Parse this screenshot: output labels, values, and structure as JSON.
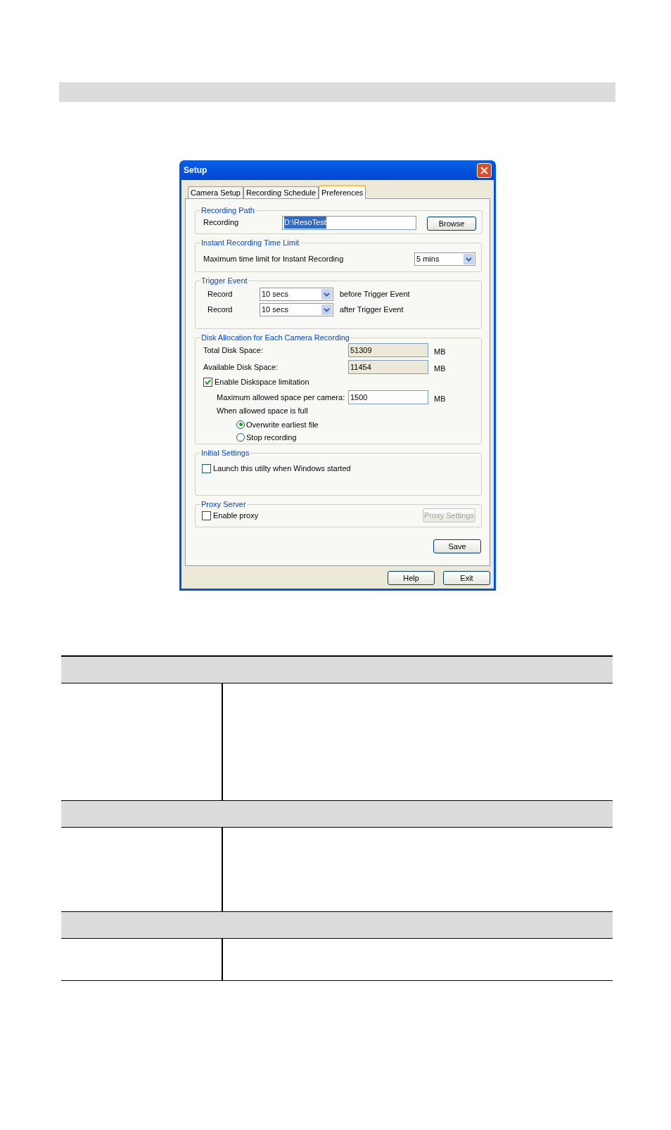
{
  "dialog": {
    "title": "Setup",
    "tabs": [
      {
        "label": "Camera Setup",
        "selected": false
      },
      {
        "label": "Recording Schedule",
        "selected": false
      },
      {
        "label": "Preferences",
        "selected": true
      }
    ],
    "recording_path": {
      "legend": "Recording Path",
      "label": "Recording",
      "value": "D:\\ResoTest",
      "browse_button": "Browse"
    },
    "instant_limit": {
      "legend": "Instant Recording Time Limit",
      "label": "Maximum time limit for Instant Recording",
      "value": "5 mins"
    },
    "trigger_event": {
      "legend": "Trigger Event",
      "rows": [
        {
          "label": "Record",
          "value": "10 secs",
          "suffix": "before Trigger Event"
        },
        {
          "label": "Record",
          "value": "10 secs",
          "suffix": "after Trigger Event"
        }
      ]
    },
    "disk_allocation": {
      "legend": "Disk Allocation for Each Camera Recording",
      "total": {
        "label": "Total Disk Space:",
        "value": "51309",
        "unit": "MB"
      },
      "available": {
        "label": "Available Disk Space:",
        "value": "11454",
        "unit": "MB"
      },
      "limit": {
        "label": "Enable Diskspace limitation",
        "checked": true
      },
      "max": {
        "label": "Maximum allowed space per camera:",
        "value": "1500",
        "unit": "MB"
      },
      "when_full": "When allowed space is full",
      "options": [
        {
          "label": "Overwrite earliest file",
          "selected": true
        },
        {
          "label": "Stop recording",
          "selected": false
        }
      ]
    },
    "initial_settings": {
      "legend": "Initial Settings",
      "launch": {
        "label": "Launch this utilty when Windows started",
        "checked": false
      }
    },
    "proxy_server": {
      "legend": "Proxy Server",
      "enable": {
        "label": "Enable proxy",
        "checked": false
      },
      "settings_button": {
        "label": "Proxy Settings",
        "disabled": true
      }
    },
    "save_button": "Save",
    "buttons": [
      "Help",
      "Exit"
    ]
  }
}
